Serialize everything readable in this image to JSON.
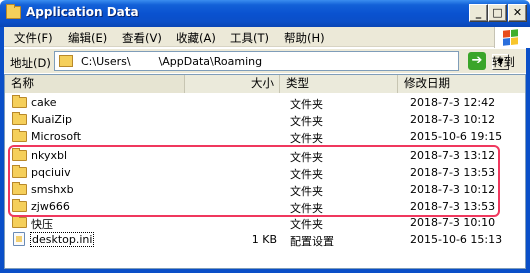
{
  "window": {
    "title": "Application Data"
  },
  "menu": [
    "文件(F)",
    "编辑(E)",
    "查看(V)",
    "收藏(A)",
    "工具(T)",
    "帮助(H)"
  ],
  "address": {
    "label": "地址(D)",
    "value": "C:\\Users\\        \\AppData\\Roaming",
    "go_label": "转到"
  },
  "columns": {
    "name": "名称",
    "size": "大小",
    "type": "类型",
    "date": "修改日期"
  },
  "rows": [
    {
      "name": "cake",
      "size": "",
      "type": "文件夹",
      "date": "2018-7-3 12:42",
      "icon": "folder-icon"
    },
    {
      "name": "KuaiZip",
      "size": "",
      "type": "文件夹",
      "date": "2018-7-3 10:12",
      "icon": "folder-icon"
    },
    {
      "name": "Microsoft",
      "size": "",
      "type": "文件夹",
      "date": "2015-10-6 19:15",
      "icon": "folder-icon"
    },
    {
      "name": "nkyxbl",
      "size": "",
      "type": "文件夹",
      "date": "2018-7-3 13:12",
      "icon": "folder-icon"
    },
    {
      "name": "pqciuiv",
      "size": "",
      "type": "文件夹",
      "date": "2018-7-3 13:53",
      "icon": "folder-icon"
    },
    {
      "name": "smshxb",
      "size": "",
      "type": "文件夹",
      "date": "2018-7-3 10:12",
      "icon": "folder-icon"
    },
    {
      "name": "zjw666",
      "size": "",
      "type": "文件夹",
      "date": "2018-7-3 13:53",
      "icon": "folder-icon"
    },
    {
      "name": "快压",
      "size": "",
      "type": "文件夹",
      "date": "2018-7-3 10:10",
      "icon": "folder-icon"
    },
    {
      "name": "desktop.ini",
      "size": "1 KB",
      "type": "配置设置",
      "date": "2015-10-6 15:13",
      "icon": "ini-file-icon"
    }
  ],
  "colors": {
    "titlebar": "#0a52d0",
    "highlight": "#f0385e",
    "chrome": "#ece9d8"
  }
}
